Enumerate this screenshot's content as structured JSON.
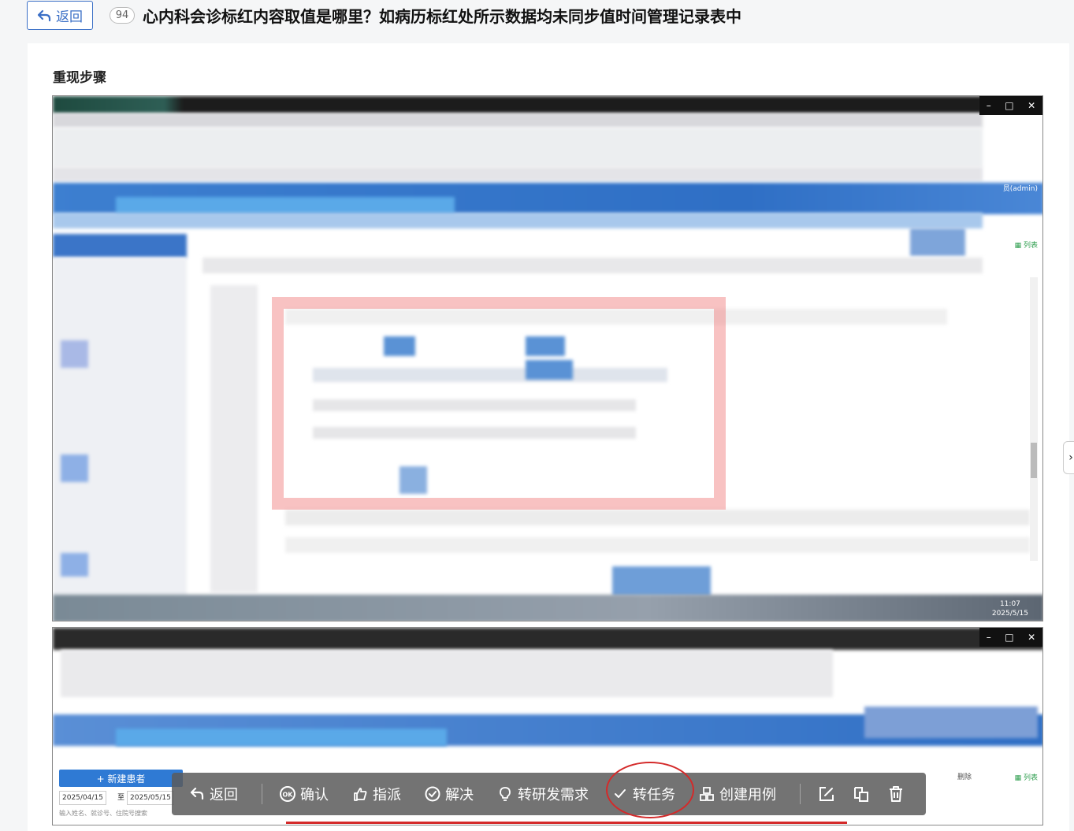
{
  "header": {
    "back_label": "返回",
    "issue_number": "94",
    "title": "心内科会诊标红内容取值是哪里？如病历标红处所示数据均未同步值时间管理记录表中"
  },
  "section": {
    "title": "重现步骤"
  },
  "screenshot1": {
    "admin_label": "员(admin)",
    "list_label": "▦ 列表",
    "time": "11:07",
    "date": "2025/5/15"
  },
  "screenshot2": {
    "new_patient_label": "+ 新建患者",
    "date_from": "2025/04/15",
    "date_sep": "至",
    "date_to": "2025/05/15",
    "search_placeholder": "输入姓名、就诊号、住院号搜索",
    "list_label": "▦ 列表",
    "delete_label": "删除"
  },
  "toolbar": {
    "items": [
      {
        "label": "返回",
        "icon": "back-icon"
      },
      {
        "label": "确认",
        "icon": "ok-icon"
      },
      {
        "label": "指派",
        "icon": "hand-point-icon"
      },
      {
        "label": "解决",
        "icon": "check-circle-icon"
      },
      {
        "label": "转研发需求",
        "icon": "lightbulb-icon"
      },
      {
        "label": "转任务",
        "icon": "check-icon"
      },
      {
        "label": "创建用例",
        "icon": "grid-icon"
      }
    ],
    "icon_buttons": [
      "edit-icon",
      "copy-icon",
      "trash-icon"
    ]
  },
  "colors": {
    "accent": "#3a6fc6",
    "annotation_red": "#d42a2a"
  }
}
